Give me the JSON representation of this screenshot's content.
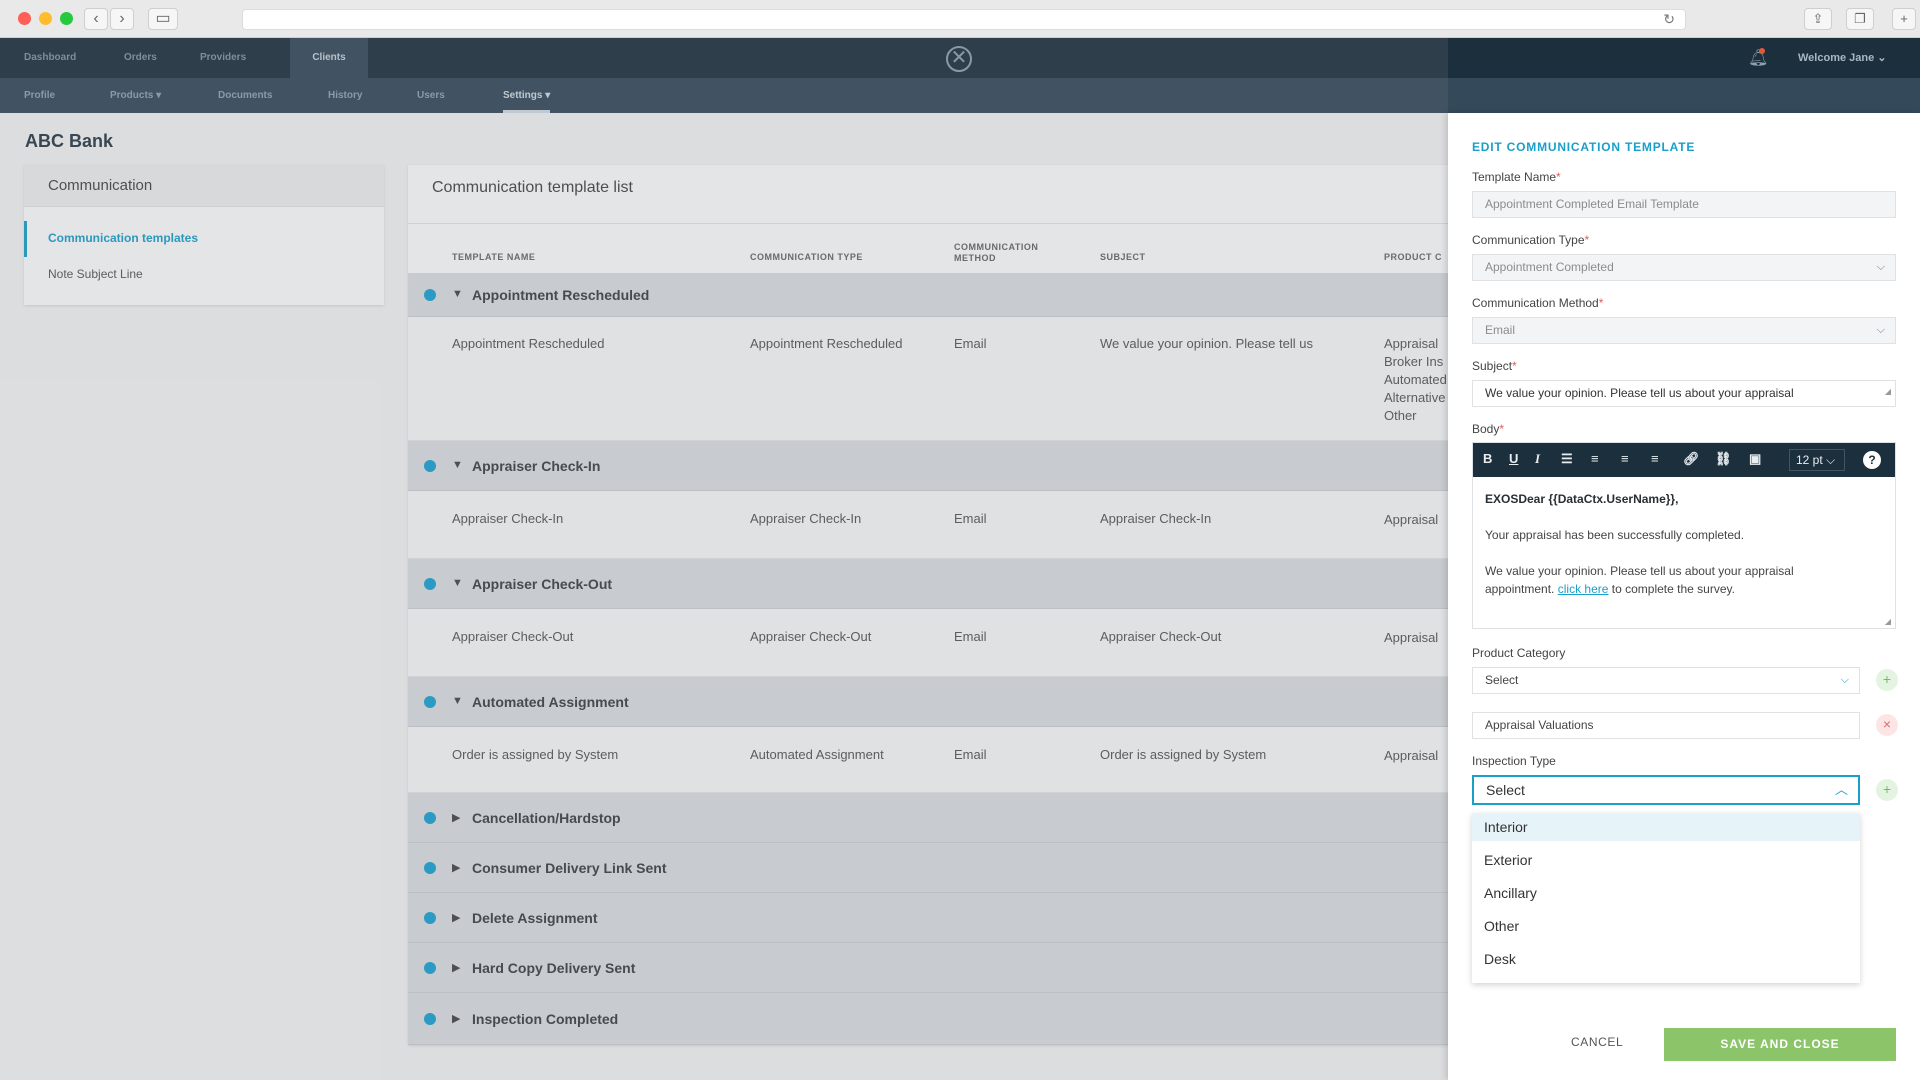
{
  "nav": {
    "top_items": [
      "Dashboard",
      "Orders",
      "Providers",
      "Clients"
    ],
    "welcome": "Welcome Jane ⌄",
    "sub_items": [
      "Profile",
      "Products ▾",
      "Documents",
      "History",
      "Users",
      "Settings ▾"
    ]
  },
  "page": {
    "company": "ABC Bank",
    "sidebar": {
      "header": "Communication",
      "items": [
        "Communication templates",
        "Note Subject Line"
      ]
    },
    "list": {
      "title": "Communication template list",
      "columns": [
        "TEMPLATE NAME",
        "COMMUNICATION TYPE",
        "COMMUNICATION\nMETHOD",
        "SUBJECT",
        "PRODUCT C"
      ],
      "groups": [
        {
          "label": "Appointment Rescheduled",
          "arrow": "▼",
          "row": {
            "name": "Appointment Rescheduled",
            "type": "Appointment Rescheduled",
            "method": "Email",
            "subject": "We value your opinion. Please tell us",
            "products": "Appraisal\nBroker Ins\nAutomated\nAlternative\nOther"
          }
        },
        {
          "label": "Appraiser Check-In",
          "arrow": "▼",
          "row": {
            "name": "Appraiser Check-In",
            "type": "Appraiser Check-In",
            "method": "Email",
            "subject": "Appraiser Check-In",
            "products": "Appraisal"
          }
        },
        {
          "label": "Appraiser Check-Out",
          "arrow": "▼",
          "row": {
            "name": "Appraiser Check-Out",
            "type": "Appraiser Check-Out",
            "method": "Email",
            "subject": "Appraiser Check-Out",
            "products": "Appraisal"
          }
        },
        {
          "label": "Automated Assignment",
          "arrow": "▼",
          "row": {
            "name": "Order is assigned by System",
            "type": "Automated Assignment",
            "method": "Email",
            "subject": "Order is assigned by System",
            "products": "Appraisal"
          }
        },
        {
          "label": "Cancellation/Hardstop",
          "arrow": "▶"
        },
        {
          "label": "Consumer Delivery Link Sent",
          "arrow": "▶"
        },
        {
          "label": "Delete Assignment",
          "arrow": "▶"
        },
        {
          "label": "Hard Copy Delivery Sent",
          "arrow": "▶"
        },
        {
          "label": "Inspection Completed",
          "arrow": "▶"
        }
      ]
    }
  },
  "panel": {
    "title": "EDIT COMMUNICATION TEMPLATE",
    "template_name_label": "Template Name",
    "template_name_value": "Appointment Completed Email Template",
    "comm_type_label": "Communication Type",
    "comm_type_value": "Appointment Completed",
    "comm_method_label": "Communication Method",
    "comm_method_value": "Email",
    "subject_label": "Subject",
    "subject_value": "We value your opinion. Please tell us about your appraisal",
    "body_label": "Body",
    "font_size": "12 pt ⌵",
    "body": {
      "line1": "EXOSDear {{DataCtx.UserName}},",
      "line2": "Your appraisal has been successfully completed.",
      "line3a": "We value your opinion. Please tell us about your appraisal",
      "line3b": "appointment.",
      "link": "click here",
      "line3c": "to complete the survey."
    },
    "product_category_label": "Product Category",
    "product_category_value": "Select",
    "product_tag": "Appraisal Valuations",
    "inspection_type_label": "Inspection Type",
    "inspection_type_value": "Select",
    "inspection_options": [
      "Interior",
      "Exterior",
      "Ancillary",
      "Other",
      "Desk"
    ],
    "cancel_label": "CANCEL",
    "save_label": "SAVE AND CLOSE"
  },
  "colors": {
    "accent": "#1a9fcb",
    "save": "#8cc46a",
    "nav": "#1c2f3d"
  }
}
